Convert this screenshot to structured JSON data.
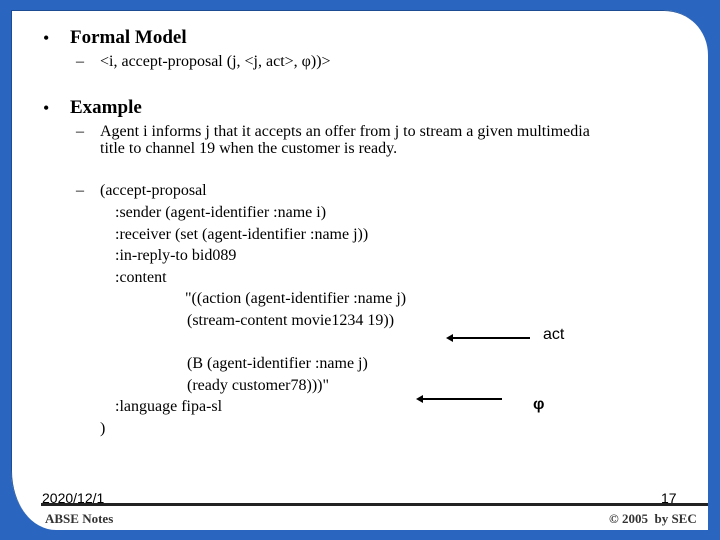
{
  "slide": {
    "bullets": [
      {
        "marker": "•",
        "heading": "Formal Model",
        "subitems": [
          {
            "marker": "–",
            "text": "<i, accept-proposal (j, <j, act>, φ))>"
          }
        ]
      },
      {
        "marker": "•",
        "heading": "Example",
        "subitems": [
          {
            "marker": "–",
            "lines": [
              "Agent i informs j that it accepts an offer from j to stream a given multimedia",
              "title to channel 19 when the customer is ready."
            ]
          },
          {
            "marker": "–",
            "code": [
              "(accept-proposal",
              ":sender (agent-identifier :name i)",
              ":receiver (set (agent-identifier :name j))",
              ":in-reply-to bid089",
              ":content",
              "\"((action (agent-identifier :name j)",
              "(stream-content movie1234 19))",
              "(B (agent-identifier :name j)",
              "(ready customer78)))\"",
              ":language fipa-sl",
              ")"
            ]
          }
        ]
      }
    ],
    "annotations": [
      {
        "label": "act",
        "arrow": "left-arrow"
      },
      {
        "label": "φ",
        "arrow": "left-arrow"
      }
    ]
  },
  "footer": {
    "date": "2020/12/1",
    "page_number": "17",
    "left_label": "ABSE Notes",
    "copyright": "© 2005  by SEC"
  },
  "colors": {
    "frame": "#2a66bf",
    "background": "#ffffff",
    "text": "#000000"
  }
}
